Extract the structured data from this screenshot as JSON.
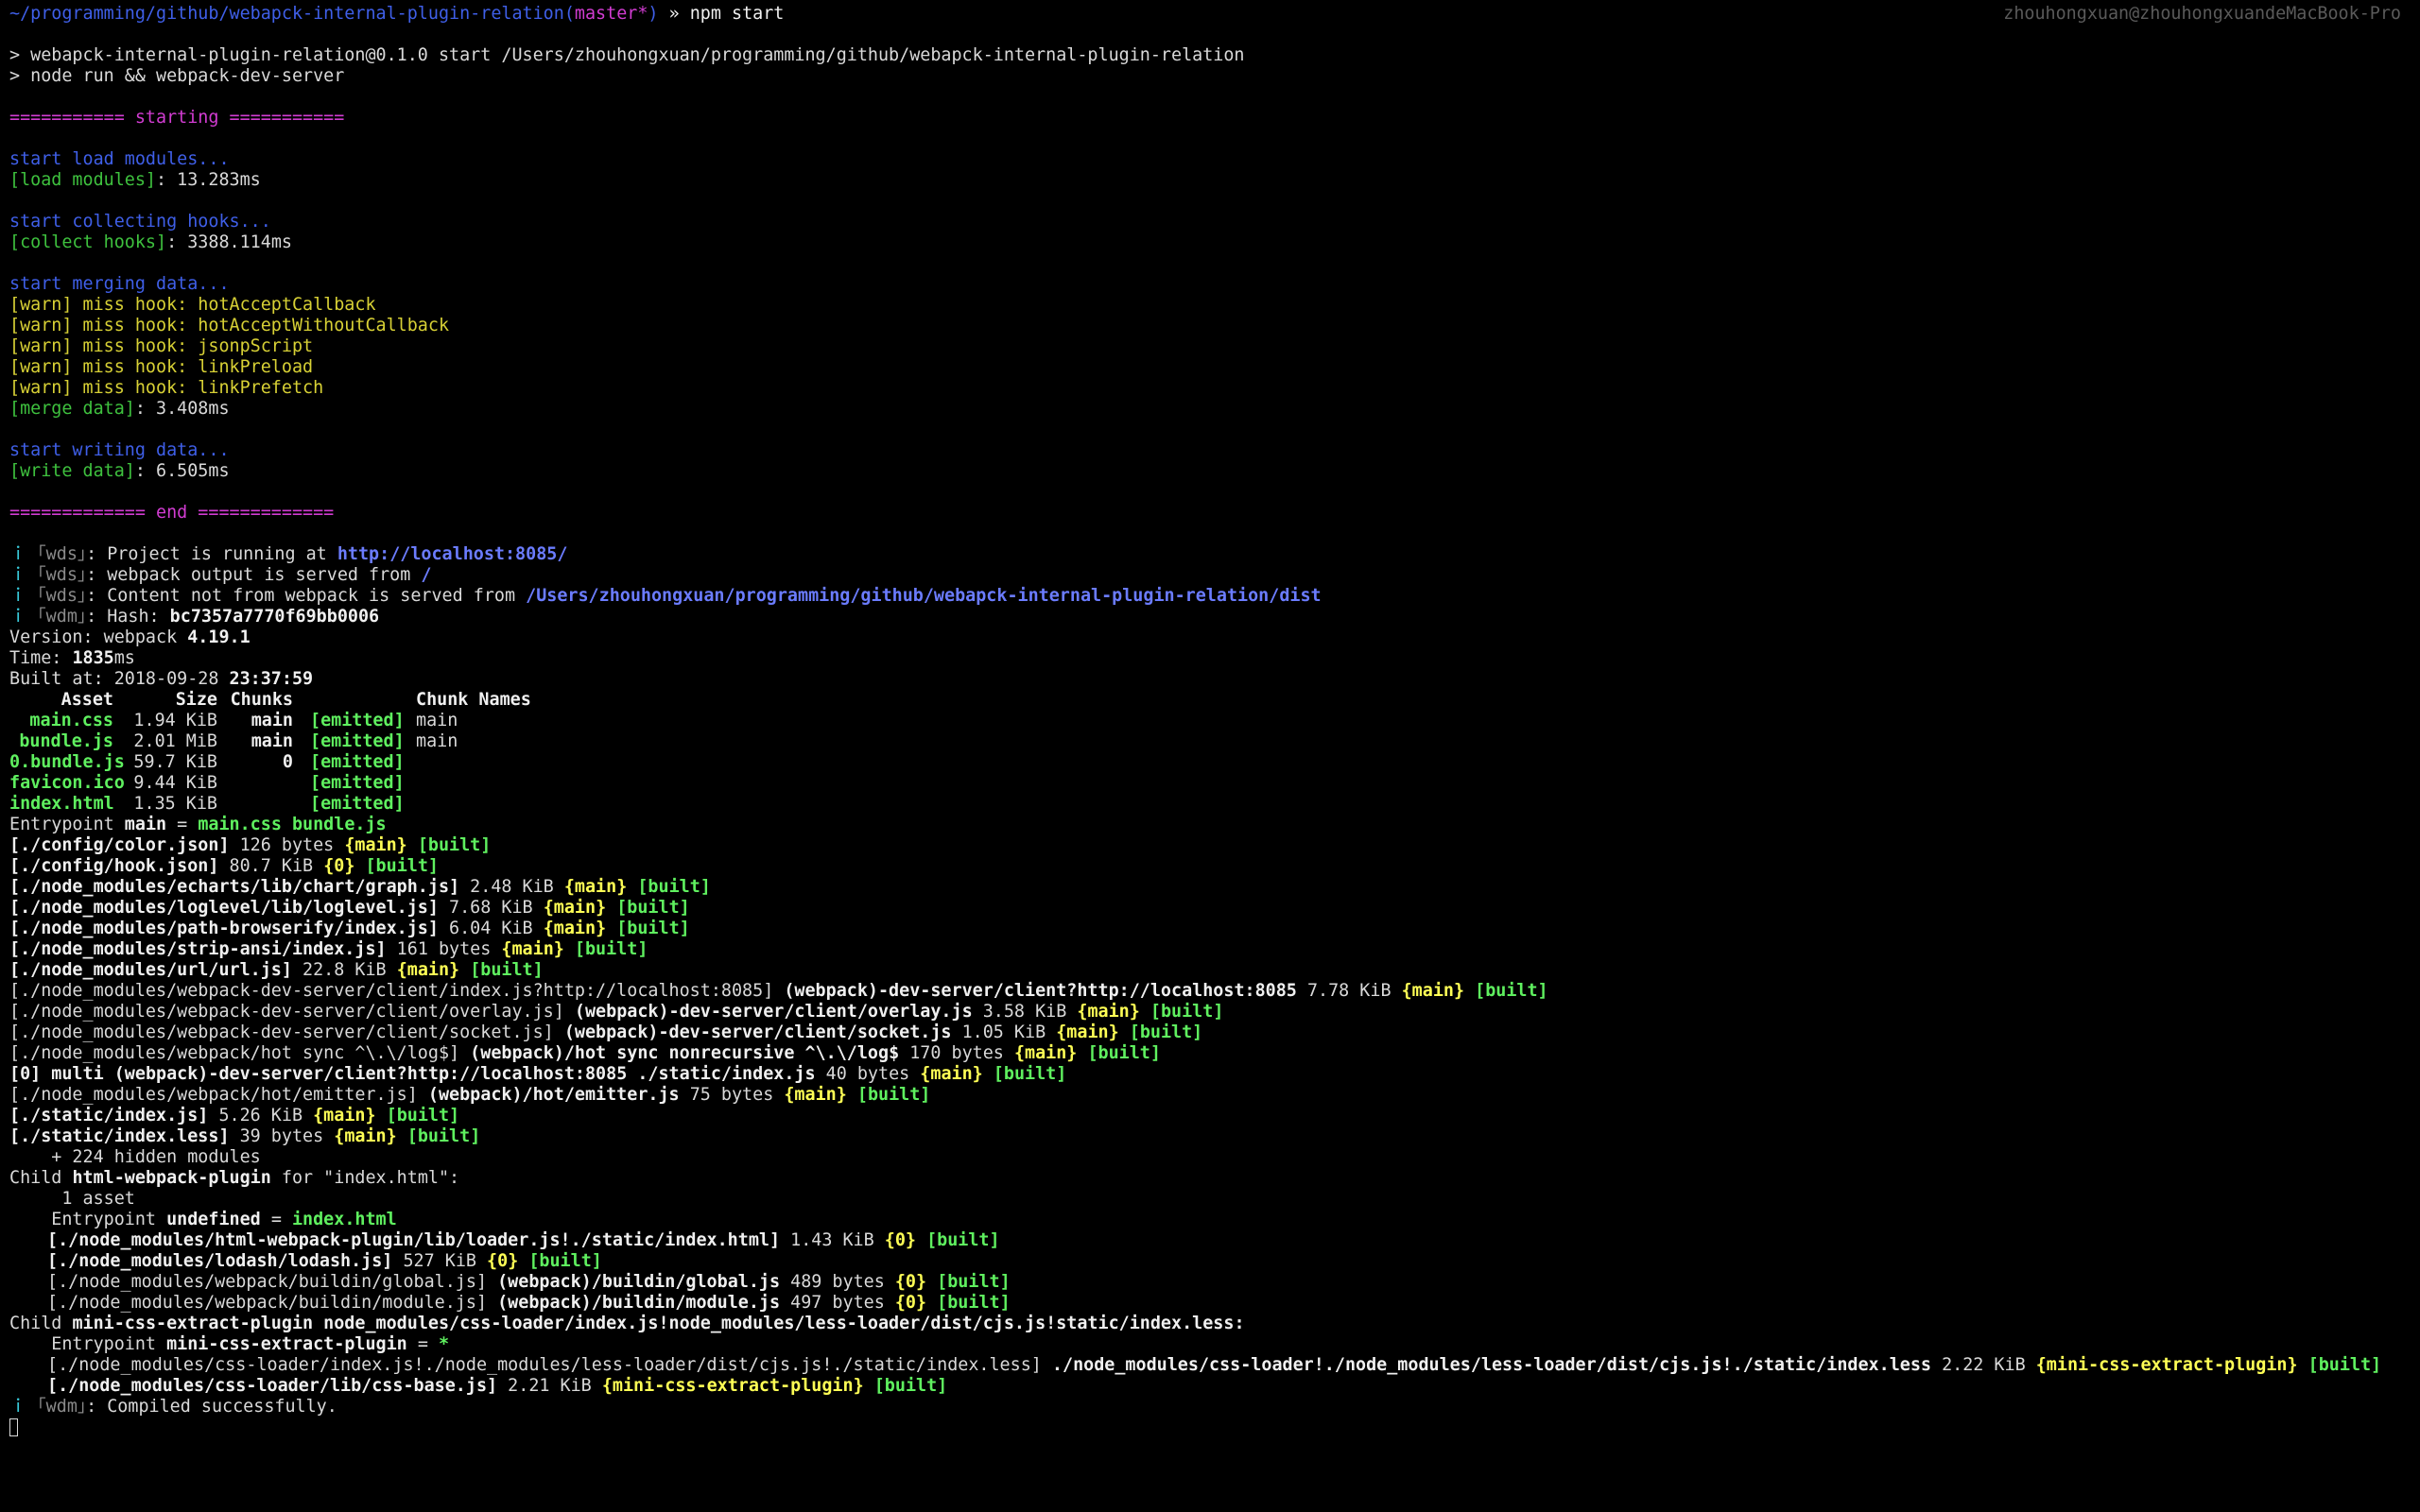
{
  "window": {
    "hostname": "zhouhongxuan@zhouhongxuandeMacBook-Pro"
  },
  "prompt": {
    "path": "~/programming/github/webapck-internal-plugin-relation",
    "branch_open": "(",
    "branch": "master*",
    "branch_close": ")",
    "arrow": " » ",
    "command": "npm start"
  },
  "npm": {
    "line1": "> webapck-internal-plugin-relation@0.1.0 start /Users/zhouhongxuan/programming/github/webapck-internal-plugin-relation",
    "line2": "> node run && webpack-dev-server"
  },
  "banner": {
    "start": "=========== starting ===========",
    "end": "============= end ============="
  },
  "steps": {
    "load_start": "start load modules...",
    "load_tag": "[load modules]",
    "load_time": ": 13.283ms",
    "collect_start": "start collecting hooks...",
    "collect_tag": "[collect hooks]",
    "collect_time": ": 3388.114ms",
    "merge_start": "start merging data...",
    "warns": [
      "[warn] miss hook: hotAcceptCallback",
      "[warn] miss hook: hotAcceptWithoutCallback",
      "[warn] miss hook: jsonpScript",
      "[warn] miss hook: linkPreload",
      "[warn] miss hook: linkPrefetch"
    ],
    "merge_tag": "[merge data]",
    "merge_time": ": 3.408ms",
    "write_start": "start writing data...",
    "write_tag": "[write data]",
    "write_time": ": 6.505ms"
  },
  "wds": {
    "i": "ｉ",
    "tag": "｢wds｣",
    "l1_text": ": Project is running at ",
    "l1_url": "http://localhost:8085/",
    "l2_text": ": webpack output is served from ",
    "l2_path": "/",
    "l3_text": ": Content not from webpack is served from ",
    "l3_path": "/Users/zhouhongxuan/programming/github/webapck-internal-plugin-relation/dist"
  },
  "wdm": {
    "tag": "｢wdm｣",
    "hash_label": ": Hash: ",
    "hash": "bc7357a7770f69bb0006",
    "compiled": ": Compiled successfully."
  },
  "build": {
    "version_label": "Version: webpack ",
    "version": "4.19.1",
    "time_label": "Time: ",
    "time_value": "1835",
    "time_unit": "ms",
    "built_label": "Built at: 2018-09-28 ",
    "built_time": "23:37:59"
  },
  "assets": {
    "headers": [
      "Asset",
      "Size",
      "Chunks",
      "Chunk Names"
    ],
    "rows": [
      {
        "asset": "main.css",
        "size": "1.94 KiB",
        "chunks": "main",
        "status": "[emitted]",
        "names": "main"
      },
      {
        "asset": "bundle.js",
        "size": "2.01 MiB",
        "chunks": "main",
        "status": "[emitted]",
        "names": "main"
      },
      {
        "asset": "0.bundle.js",
        "size": "59.7 KiB",
        "chunks": "0",
        "status": "[emitted]",
        "names": ""
      },
      {
        "asset": "favicon.ico",
        "size": "9.44 KiB",
        "chunks": "",
        "status": "[emitted]",
        "names": ""
      },
      {
        "asset": "index.html",
        "size": "1.35 KiB",
        "chunks": "",
        "status": "[emitted]",
        "names": ""
      }
    ]
  },
  "entrypoint": {
    "label": "Entrypoint ",
    "name": "main",
    "eq": " = ",
    "files": "main.css bundle.js"
  },
  "modules": [
    {
      "path": "[./config/color.json]",
      "alias": "",
      "size": " 126 bytes ",
      "chunk": "{main}",
      "status": " [built]"
    },
    {
      "path": "[./config/hook.json]",
      "alias": "",
      "size": " 80.7 KiB ",
      "chunk": "{0}",
      "status": " [built]"
    },
    {
      "path": "[./node_modules/echarts/lib/chart/graph.js]",
      "alias": "",
      "size": " 2.48 KiB ",
      "chunk": "{main}",
      "status": " [built]"
    },
    {
      "path": "[./node_modules/loglevel/lib/loglevel.js]",
      "alias": "",
      "size": " 7.68 KiB ",
      "chunk": "{main}",
      "status": " [built]"
    },
    {
      "path": "[./node_modules/path-browserify/index.js]",
      "alias": "",
      "size": " 6.04 KiB ",
      "chunk": "{main}",
      "status": " [built]"
    },
    {
      "path": "[./node_modules/strip-ansi/index.js]",
      "alias": "",
      "size": " 161 bytes ",
      "chunk": "{main}",
      "status": " [built]"
    },
    {
      "path": "[./node_modules/url/url.js]",
      "alias": "",
      "size": " 22.8 KiB ",
      "chunk": "{main}",
      "status": " [built]"
    },
    {
      "path": "[./node_modules/webpack-dev-server/client/index.js?http://localhost:8085]",
      "alias": " (webpack)-dev-server/client?http://localhost:8085",
      "size": " 7.78 KiB ",
      "chunk": "{main}",
      "status": " [built]"
    },
    {
      "path": "[./node_modules/webpack-dev-server/client/overlay.js]",
      "alias": " (webpack)-dev-server/client/overlay.js",
      "size": " 3.58 KiB ",
      "chunk": "{main}",
      "status": " [built]"
    },
    {
      "path": "[./node_modules/webpack-dev-server/client/socket.js]",
      "alias": " (webpack)-dev-server/client/socket.js",
      "size": " 1.05 KiB ",
      "chunk": "{main}",
      "status": " [built]"
    },
    {
      "path": "[./node_modules/webpack/hot sync ^\\.\\/log$]",
      "alias": " (webpack)/hot sync nonrecursive ^\\.\\/log$",
      "size": " 170 bytes ",
      "chunk": "{main}",
      "status": " [built]"
    },
    {
      "path": "[0] multi",
      "alias": " (webpack)-dev-server/client?http://localhost:8085 ./static/index.js",
      "size": " 40 bytes ",
      "chunk": "{main}",
      "status": " [built]"
    },
    {
      "path": "[./node_modules/webpack/hot/emitter.js]",
      "alias": " (webpack)/hot/emitter.js",
      "size": " 75 bytes ",
      "chunk": "{main}",
      "status": " [built]"
    },
    {
      "path": "[./static/index.js]",
      "alias": "",
      "size": " 5.26 KiB ",
      "chunk": "{main}",
      "status": " [built]"
    },
    {
      "path": "[./static/index.less]",
      "alias": "",
      "size": " 39 bytes ",
      "chunk": "{main}",
      "status": " [built]"
    }
  ],
  "hidden": "    + 224 hidden modules",
  "child1": {
    "prefix": "Child ",
    "name": "html-webpack-plugin",
    "rest": " for \"index.html\":",
    "asset_count": "     1 asset",
    "entry_label": "    Entrypoint ",
    "entry_name": "undefined",
    "entry_eq": " = ",
    "entry_file": "index.html",
    "modules": [
      {
        "path": "[./node_modules/html-webpack-plugin/lib/loader.js!./static/index.html]",
        "alias": "",
        "size": " 1.43 KiB ",
        "chunk": "{0}",
        "status": " [built]"
      },
      {
        "path": "[./node_modules/lodash/lodash.js]",
        "alias": "",
        "size": " 527 KiB ",
        "chunk": "{0}",
        "status": " [built]"
      },
      {
        "path": "[./node_modules/webpack/buildin/global.js]",
        "alias": " (webpack)/buildin/global.js",
        "size": " 489 bytes ",
        "chunk": "{0}",
        "status": " [built]"
      },
      {
        "path": "[./node_modules/webpack/buildin/module.js]",
        "alias": " (webpack)/buildin/module.js",
        "size": " 497 bytes ",
        "chunk": "{0}",
        "status": " [built]"
      }
    ]
  },
  "child2": {
    "prefix": "Child ",
    "name": "mini-css-extract-plugin node_modules/css-loader/index.js!node_modules/less-loader/dist/cjs.js!static/index.less:",
    "entry_label": "    Entrypoint ",
    "entry_name": "mini-css-extract-plugin",
    "entry_eq": " = ",
    "entry_file": "*",
    "modules": [
      {
        "path": "[./node_modules/css-loader/index.js!./node_modules/less-loader/dist/cjs.js!./static/index.less]",
        "alias": " ./node_modules/css-loader!./node_modules/less-loader/dist/cjs.js!./static/index.less",
        "size": " 2.22 KiB ",
        "chunk": "{mini-css-extract-plugin}",
        "status": " [built]"
      },
      {
        "path": "[./node_modules/css-loader/lib/css-base.js]",
        "alias": "",
        "size": " 2.21 KiB ",
        "chunk": "{mini-css-extract-plugin}",
        "status": " [built]"
      }
    ]
  }
}
